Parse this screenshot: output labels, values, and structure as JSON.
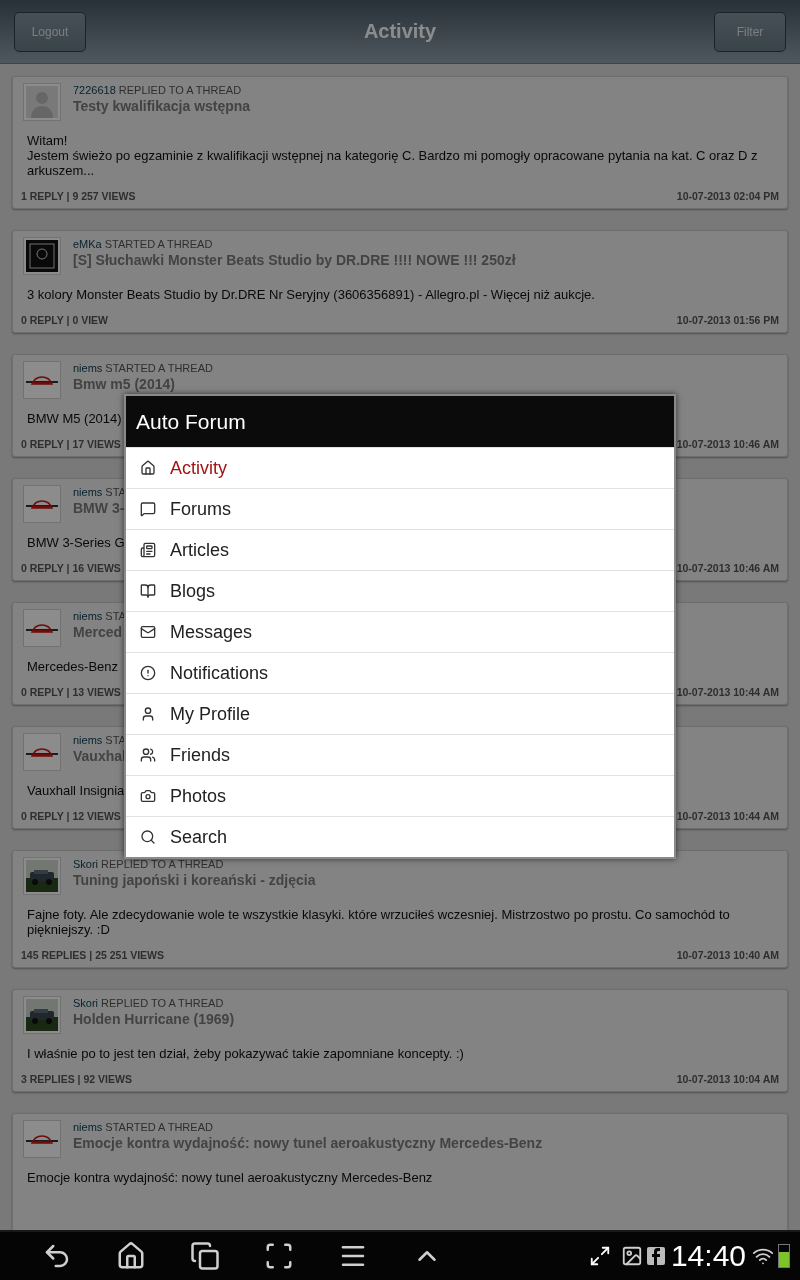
{
  "header": {
    "left_button": "Logout",
    "title": "Activity",
    "right_button": "Filter"
  },
  "posts": [
    {
      "kind": "default",
      "author": "7226618",
      "action": "REPLIED TO A THREAD",
      "title": "Testy kwalifikacja wstępna",
      "body": "Witam!\nJestem świeżo po egzaminie z kwalifikacji wstępnej na kategorię C. Bardzo mi pomogły opracowane pytania na kat. C oraz D z arkuszem...",
      "stats": "1 REPLY | 9 257 VIEWS",
      "date": "10-07-2013 02:04 PM"
    },
    {
      "kind": "logo",
      "author": "eMKa",
      "action": "STARTED A THREAD",
      "title": "[S] Słuchawki Monster Beats Studio by DR.DRE !!!! NOWE !!! 250zł",
      "body": "3 kolory Monster Beats Studio by Dr.DRE Nr Seryjny (3606356891) - Allegro.pl - Więcej niż aukcje.",
      "stats": "0 REPLY | 0 VIEW",
      "date": "10-07-2013 01:56 PM"
    },
    {
      "kind": "car",
      "author": "niems",
      "action": "STARTED A THREAD",
      "title": "Bmw m5 (2014)",
      "body": "BMW M5 (2014)",
      "stats": "0 REPLY | 17 VIEWS",
      "date": "10-07-2013 10:46 AM"
    },
    {
      "kind": "car",
      "author": "niems",
      "action": "STA",
      "title": "BMW 3-",
      "body": "BMW 3-Series G",
      "stats": "0 REPLY | 16 VIEWS",
      "date": "10-07-2013 10:46 AM"
    },
    {
      "kind": "car",
      "author": "niems",
      "action": "STA",
      "title": "Merced",
      "body": "Mercedes-Benz",
      "stats": "0 REPLY | 13 VIEWS",
      "date": "10-07-2013 10:44 AM"
    },
    {
      "kind": "car",
      "author": "niems",
      "action": "STA",
      "title": "Vauxhal",
      "body": "Vauxhall Insignia",
      "stats": "0 REPLY | 12 VIEWS",
      "date": "10-07-2013 10:44 AM"
    },
    {
      "author": "Skori",
      "action": "REPLIED TO A THREAD",
      "title": "Tuning japoński i koreański - zdjęcia",
      "body": "Fajne foty. Ale zdecydowanie wole te wszystkie klasyki. które wrzuciłeś wczesniej. Mistrzostwo po prostu. Co samochód to piękniejszy. :D",
      "stats": "145 REPLIES | 25 251 VIEWS",
      "date": "10-07-2013 10:40 AM"
    },
    {
      "author": "Skori",
      "action": "REPLIED TO A THREAD",
      "title": "Holden Hurricane (1969)",
      "body": "I właśnie po to jest ten dział, żeby pokazywać takie zapomniane koncepty. :)",
      "stats": "3 REPLIES | 92 VIEWS",
      "date": "10-07-2013 10:04 AM"
    },
    {
      "kind": "car",
      "author": "niems",
      "action": "STARTED A THREAD",
      "title": "Emocje kontra wydajność:  nowy tunel aeroakustyczny Mercedes-Benz",
      "body": "Emocje kontra wydajność:  nowy tunel aeroakustyczny Mercedes-Benz"
    }
  ],
  "dialog": {
    "title": "Auto Forum",
    "items": [
      {
        "label": "Activity",
        "selected": true
      },
      {
        "label": "Forums",
        "selected": false
      },
      {
        "label": "Articles",
        "selected": false
      },
      {
        "label": "Blogs",
        "selected": false
      },
      {
        "label": "Messages",
        "selected": false
      },
      {
        "label": "Notifications",
        "selected": false
      },
      {
        "label": "My Profile",
        "selected": false
      },
      {
        "label": "Friends",
        "selected": false
      },
      {
        "label": "Photos",
        "selected": false
      },
      {
        "label": "Search",
        "selected": false
      }
    ]
  },
  "status_bar": {
    "time": "14:40"
  }
}
